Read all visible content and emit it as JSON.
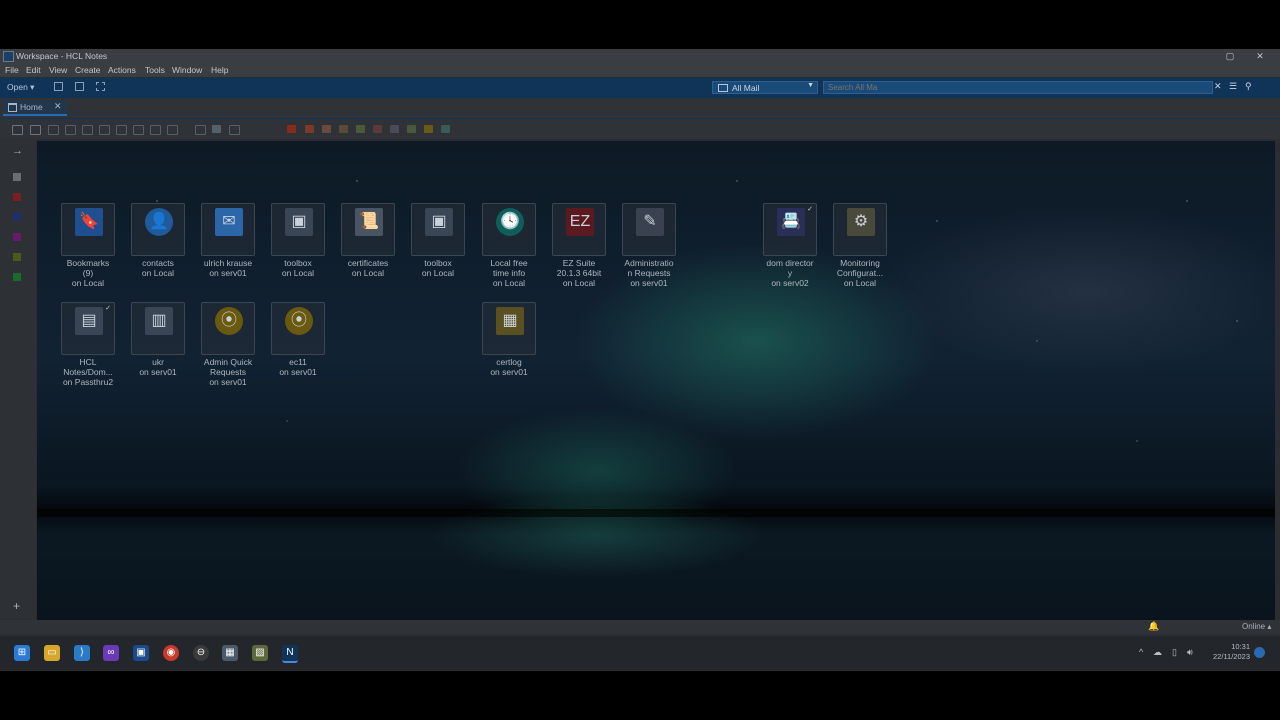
{
  "window": {
    "title": "Workspace - HCL Notes"
  },
  "window_controls": {
    "restore": "▢",
    "close": "✕"
  },
  "menu": [
    "File",
    "Edit",
    "View",
    "Create",
    "Actions",
    "Tools",
    "Window",
    "Help"
  ],
  "toolbar": {
    "open_label": "Open",
    "mail_scope": "All Mail",
    "search_placeholder": "Search All Ma",
    "clear_glyph": "✕",
    "search_glyph": "⚲"
  },
  "tabs": [
    {
      "label": "Home",
      "close": "✕"
    }
  ],
  "tiles": [
    {
      "line1": "Bookmarks",
      "line2": "(9)",
      "line3": "on Local",
      "icon": "bookmark-icon",
      "color": "#1f4f8f",
      "glyph": "🔖"
    },
    {
      "line1": "contacts",
      "line2": "on Local",
      "line3": "",
      "icon": "contacts-icon",
      "color": "#1f5a9a",
      "glyph": "👤"
    },
    {
      "line1": "ulrich krause",
      "line2": "on serv01",
      "line3": "",
      "icon": "mail-envelope-icon",
      "color": "#2a66a8",
      "glyph": "✉"
    },
    {
      "line1": "toolbox",
      "line2": "on Local",
      "line3": "",
      "icon": "database-icon",
      "color": "#3a4656",
      "glyph": "▣"
    },
    {
      "line1": "certificates",
      "line2": "on Local",
      "line3": "",
      "icon": "certificate-icon",
      "color": "#4a5563",
      "glyph": "📜"
    },
    {
      "line1": "toolbox",
      "line2": "on Local",
      "line3": "",
      "icon": "database-icon",
      "color": "#3a4656",
      "glyph": "▣"
    },
    {
      "line1": "Local free",
      "line2": "time info",
      "line3": "on Local",
      "icon": "clock-icon",
      "color": "#0f5e5a",
      "glyph": "🕓"
    },
    {
      "line1": "EZ Suite",
      "line2": "20.1.3 64bit",
      "line3": "on Local",
      "icon": "ez-suite-icon",
      "color": "#5a1a1f",
      "glyph": "EZ"
    },
    {
      "line1": "Administratio",
      "line2": "n Requests",
      "line3": "on serv01",
      "icon": "admin-requests-icon",
      "color": "#3a4150",
      "glyph": "✎"
    },
    {
      "line1": "dom director",
      "line2": "y",
      "line3": "on serv02",
      "icon": "directory-icon",
      "color": "#2a2f5a",
      "glyph": "📇"
    },
    {
      "line1": "Monitoring",
      "line2": "Configurat...",
      "line3": "on Local",
      "icon": "monitoring-icon",
      "color": "#4a4a3a",
      "glyph": "⚙"
    },
    {
      "line1": "HCL",
      "line2": "Notes/Dom...",
      "line3": "on Passthru2",
      "icon": "notes-domino-icon",
      "color": "#3a4656",
      "glyph": "▤"
    },
    {
      "line1": "ukr",
      "line2": "on serv01",
      "line3": "",
      "icon": "ukr-db-icon",
      "color": "#3a4656",
      "glyph": "▥"
    },
    {
      "line1": "Admin Quick",
      "line2": "Requests",
      "line3": "on serv01",
      "icon": "quick-requests-icon",
      "color": "#6a5a10",
      "glyph": "⦿"
    },
    {
      "line1": "ec11",
      "line2": "on serv01",
      "line3": "",
      "icon": "ec11-icon",
      "color": "#6a5a10",
      "glyph": "⦿"
    },
    {
      "line1": "certlog",
      "line2": "on serv01",
      "line3": "",
      "icon": "certlog-icon",
      "color": "#5a5020",
      "glyph": "▦"
    }
  ],
  "sidebar": {
    "arrow": "→",
    "plus": "+",
    "colors": [
      "#6a6e74",
      "#7a1f22",
      "#1f2f6a",
      "#6a1a6a",
      "#4a5a1a",
      "#1a6a2a"
    ]
  },
  "status": {
    "connection": "Online ▴"
  },
  "taskbar": {
    "time": "10:31",
    "date": "22/11/2023"
  }
}
